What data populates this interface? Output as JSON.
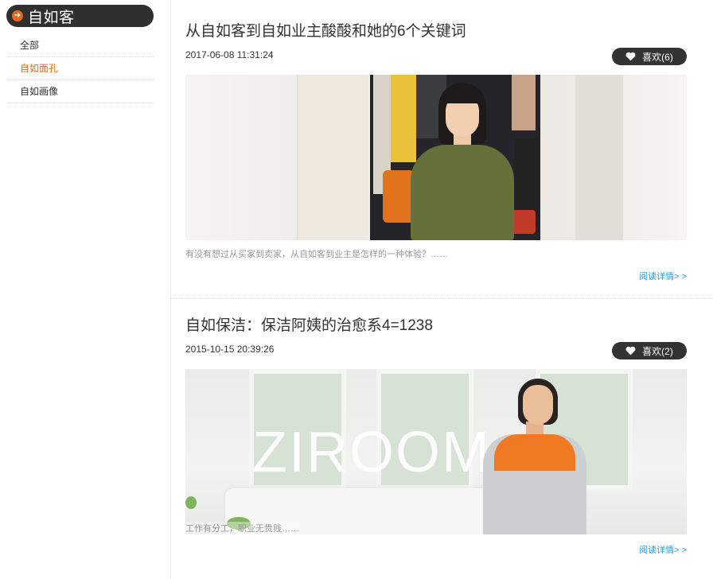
{
  "sidebar": {
    "brand": "自如客",
    "items": [
      {
        "label": "全部"
      },
      {
        "label": "自如面孔"
      },
      {
        "label": "自如画像"
      }
    ]
  },
  "articles": [
    {
      "title": "从自如客到自如业主酸酸和她的6个关键词",
      "date": "2017-06-08 11:31:24",
      "like": "喜欢(6)",
      "summary": "有没有想过从买家到卖家，从自如客到业主是怎样的一种体验？……",
      "readmore": "阅读详情> >"
    },
    {
      "title": "自如保洁：保洁阿姨的治愈系4=1238",
      "date": "2015-10-15 20:39:26",
      "like": "喜欢(2)",
      "image_text": "ZIROOM",
      "summary": "工作有分工，职业无贵贱……",
      "readmore": "阅读详情> >"
    }
  ],
  "colors": {
    "accent": "#e26a1d",
    "link": "#2c9ad7",
    "dark": "#333333"
  }
}
